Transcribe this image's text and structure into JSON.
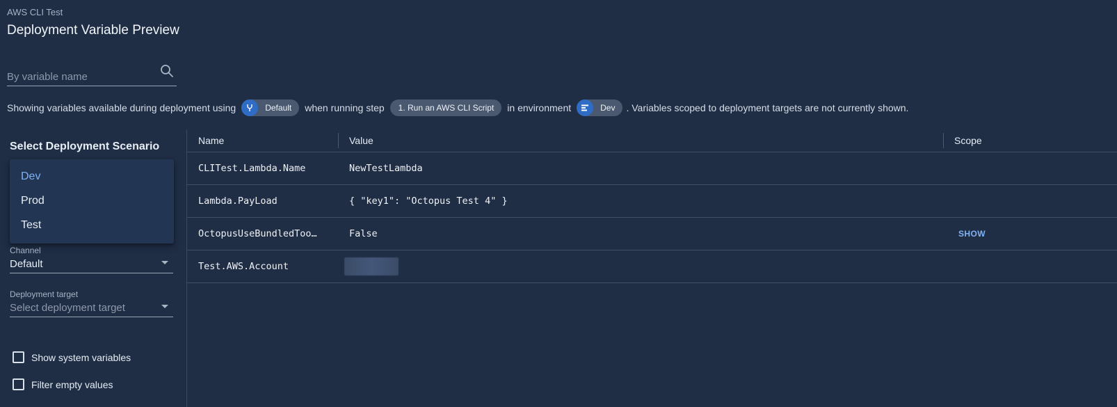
{
  "header": {
    "project_name": "AWS CLI Test",
    "title": "Deployment Variable Preview"
  },
  "search": {
    "placeholder": "By variable name",
    "icon": "search-icon"
  },
  "summary": {
    "prefix": "Showing variables available during deployment using",
    "channel_chip": "Default",
    "channel_icon": "channel-icon",
    "step_text": "when running step",
    "step_chip": "1. Run an AWS CLI Script",
    "env_text": "in environment",
    "env_chip": "Dev",
    "env_icon": "environment-icon",
    "suffix": ". Variables scoped to deployment targets are not currently shown."
  },
  "scenario": {
    "title": "Select Deployment Scenario",
    "environments": [
      "Dev",
      "Prod",
      "Test"
    ],
    "selected_environment": "Dev",
    "channel_label": "Channel",
    "channel_value": "Default",
    "target_label": "Deployment target",
    "target_placeholder": "Select deployment target",
    "show_system_variables": "Show system variables",
    "filter_empty_values": "Filter empty values"
  },
  "table": {
    "columns": [
      "Name",
      "Value",
      "Scope"
    ],
    "rows": [
      {
        "name": "CLITest.Lambda.Name",
        "value": "NewTestLambda"
      },
      {
        "name": "Lambda.PayLoad",
        "value": "{ \"key1\": \"Octopus Test 4\" }"
      },
      {
        "name": "OctopusUseBundledToo…",
        "value": "False",
        "action": "SHOW"
      },
      {
        "name": "Test.AWS.Account",
        "value": ""
      }
    ]
  },
  "colors": {
    "background": "#1f2d45",
    "chip": "#4a5970",
    "chip_icon": "#2f6cc6",
    "accent": "#7fb3f5"
  }
}
